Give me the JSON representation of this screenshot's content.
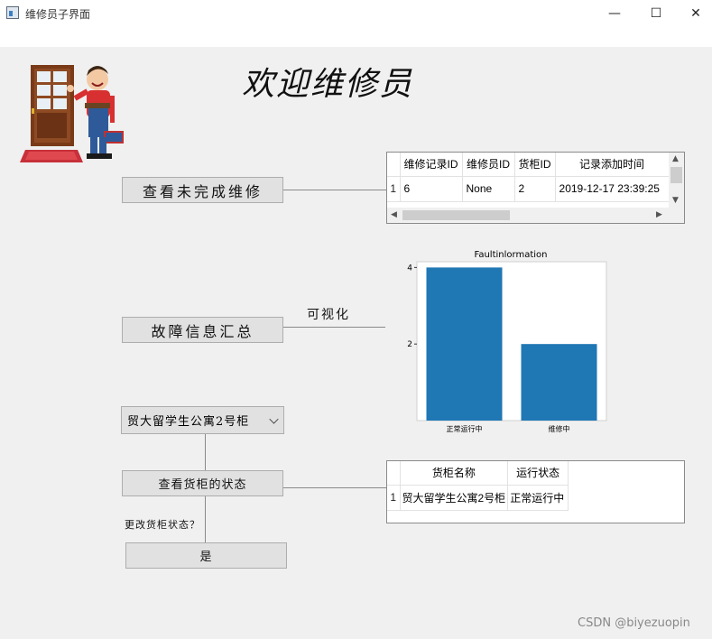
{
  "window": {
    "title": "维修员子界面",
    "minimize": "—",
    "maximize": "☐",
    "close": "✕"
  },
  "welcome": "欢迎维修员",
  "buttons": {
    "view_unfinished": "查看未完成维修",
    "fault_summary": "故障信息汇总",
    "view_cabinet_status": "查看货柜的状态",
    "confirm": "是"
  },
  "labels": {
    "visualize": "可视化",
    "change_status": "更改货柜状态？"
  },
  "cabinet_select": {
    "selected": "贸大留学生公寓2号柜"
  },
  "repair_table": {
    "headers": [
      "维修记录ID",
      "维修员ID",
      "货柜ID",
      "记录添加时间"
    ],
    "rows": [
      {
        "index": "1",
        "cells": [
          "6",
          "None",
          "2",
          "2019-12-17 23:39:25"
        ]
      }
    ]
  },
  "cabinet_table": {
    "headers": [
      "货柜名称",
      "运行状态"
    ],
    "rows": [
      {
        "index": "1",
        "cells": [
          "贸大留学生公寓2号柜",
          "正常运行中"
        ]
      }
    ]
  },
  "chart_data": {
    "type": "bar",
    "title": "Faultinlormation",
    "categories": [
      "正常运行中",
      "维修中"
    ],
    "values": [
      4,
      2
    ],
    "ylim": [
      0,
      4.15
    ],
    "yticks": [
      "2",
      "4"
    ],
    "color": "#1f77b4"
  },
  "watermark": "CSDN @biyezuopin"
}
